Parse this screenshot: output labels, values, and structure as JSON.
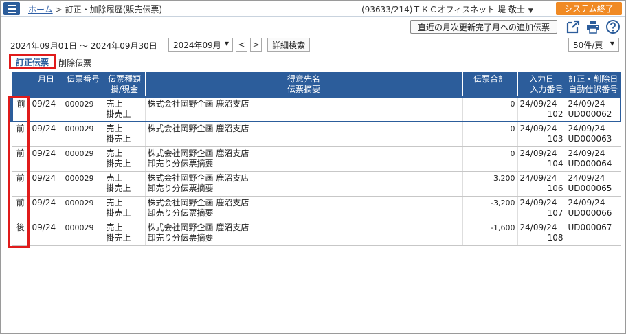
{
  "header": {
    "breadcrumb_home": "ホーム",
    "breadcrumb_sep": ">",
    "breadcrumb_current": "訂正・加除履歴(販売伝票)",
    "user": "(93633/214)ＴＫＣオフィスネット 堤 敬士",
    "system_end": "システム終了",
    "accent": "#2c5d9b",
    "system_end_color": "#f08a24"
  },
  "toolbar": {
    "add_button": "直近の月次更新完了月への追加伝票",
    "icons": [
      "external-link-icon",
      "print-icon",
      "help-icon"
    ]
  },
  "filter": {
    "period": "2024年09月01日 〜 2024年09月30日",
    "month": "2024年09月",
    "prev": "<",
    "next": ">",
    "detail_search": "詳細検索",
    "per_page": "50件/頁"
  },
  "tabs": {
    "active": "訂正伝票",
    "inactive": "削除伝票"
  },
  "table": {
    "headers": [
      {
        "l1": "",
        "l2": ""
      },
      {
        "l1": "月日",
        "l2": ""
      },
      {
        "l1": "伝票番号",
        "l2": ""
      },
      {
        "l1": "伝票種類",
        "l2": "掛/現金"
      },
      {
        "l1": "得意先名",
        "l2": "伝票摘要"
      },
      {
        "l1": "伝票合計",
        "l2": ""
      },
      {
        "l1": "入力日",
        "l2": "入力番号"
      },
      {
        "l1": "訂正・削除日",
        "l2": "自動仕訳番号"
      }
    ],
    "rows": [
      {
        "flag": "前",
        "date": "09/24",
        "no": "000029",
        "type1": "売上",
        "type2": "掛売上",
        "cust": "株式会社岡野企画 鹿沼支店",
        "memo": "",
        "total": "0",
        "input_date": "24/09/24",
        "input_no": "102",
        "fix_date": "24/09/24",
        "journal": "UD000062"
      },
      {
        "flag": "前",
        "date": "09/24",
        "no": "000029",
        "type1": "売上",
        "type2": "掛売上",
        "cust": "株式会社岡野企画 鹿沼支店",
        "memo": "",
        "total": "0",
        "input_date": "24/09/24",
        "input_no": "103",
        "fix_date": "24/09/24",
        "journal": "UD000063"
      },
      {
        "flag": "前",
        "date": "09/24",
        "no": "000029",
        "type1": "売上",
        "type2": "掛売上",
        "cust": "株式会社岡野企画 鹿沼支店",
        "memo": "卸売り分伝票摘要",
        "total": "0",
        "input_date": "24/09/24",
        "input_no": "104",
        "fix_date": "24/09/24",
        "journal": "UD000064"
      },
      {
        "flag": "前",
        "date": "09/24",
        "no": "000029",
        "type1": "売上",
        "type2": "掛売上",
        "cust": "株式会社岡野企画 鹿沼支店",
        "memo": "卸売り分伝票摘要",
        "total": "3,200",
        "input_date": "24/09/24",
        "input_no": "106",
        "fix_date": "24/09/24",
        "journal": "UD000065"
      },
      {
        "flag": "前",
        "date": "09/24",
        "no": "000029",
        "type1": "売上",
        "type2": "掛売上",
        "cust": "株式会社岡野企画 鹿沼支店",
        "memo": "卸売り分伝票摘要",
        "total": "-3,200",
        "input_date": "24/09/24",
        "input_no": "107",
        "fix_date": "24/09/24",
        "journal": "UD000066"
      },
      {
        "flag": "後",
        "date": "09/24",
        "no": "000029",
        "type1": "売上",
        "type2": "掛売上",
        "cust": "株式会社岡野企画 鹿沼支店",
        "memo": "卸売り分伝票摘要",
        "total": "-1,600",
        "input_date": "24/09/24",
        "input_no": "108",
        "fix_date": "",
        "journal": "UD000067"
      }
    ]
  }
}
